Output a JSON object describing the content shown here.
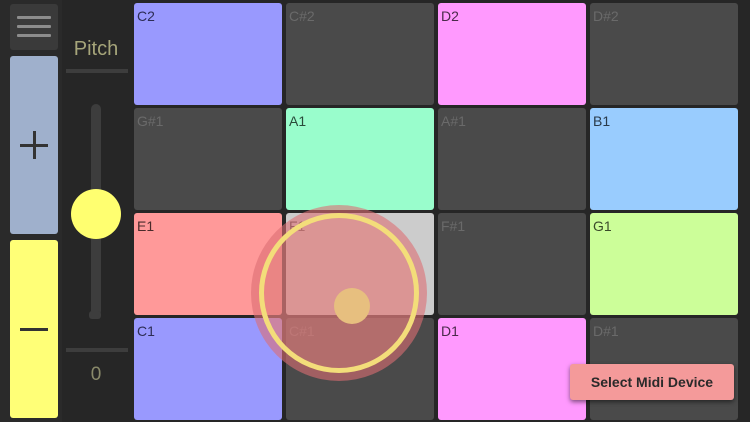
{
  "left_panel": {
    "menu_icon": "hamburger-menu-icon",
    "plus_icon": "plus-icon",
    "minus_icon": "minus-icon"
  },
  "pitch": {
    "label": "Pitch",
    "value": "0",
    "level": 0.5
  },
  "pads": [
    {
      "label": "C2",
      "color": "#9999fe",
      "label_color": "#2d2d55",
      "dim": false
    },
    {
      "label": "C#2",
      "color": "#4a4a4a",
      "label_color": "#6a6a6a",
      "dim": true
    },
    {
      "label": "D2",
      "color": "#ff99fe",
      "label_color": "#4a2a4a",
      "dim": false
    },
    {
      "label": "D#2",
      "color": "#4a4a4a",
      "label_color": "#6a6a6a",
      "dim": true
    },
    {
      "label": "G#1",
      "color": "#4a4a4a",
      "label_color": "#6a6a6a",
      "dim": true
    },
    {
      "label": "A1",
      "color": "#99fdcc",
      "label_color": "#2a4a3a",
      "dim": false
    },
    {
      "label": "A#1",
      "color": "#4a4a4a",
      "label_color": "#6a6a6a",
      "dim": true
    },
    {
      "label": "B1",
      "color": "#99ccfe",
      "label_color": "#2a3a4a",
      "dim": false
    },
    {
      "label": "E1",
      "color": "#ff9999",
      "label_color": "#4a2a2a",
      "dim": false
    },
    {
      "label": "F1",
      "color": "#cccccc",
      "label_color": "#4a4a4a",
      "dim": false
    },
    {
      "label": "F#1",
      "color": "#4a4a4a",
      "label_color": "#6a6a6a",
      "dim": true
    },
    {
      "label": "G1",
      "color": "#ccfe99",
      "label_color": "#3a4a2a",
      "dim": false
    },
    {
      "label": "C1",
      "color": "#9999fe",
      "label_color": "#2d2d55",
      "dim": false
    },
    {
      "label": "C#1",
      "color": "#4a4a4a",
      "label_color": "#6a6a6a",
      "dim": true
    },
    {
      "label": "D1",
      "color": "#ff99fe",
      "label_color": "#4a2a4a",
      "dim": false
    },
    {
      "label": "D#1",
      "color": "#4a4a4a",
      "label_color": "#6a6a6a",
      "dim": true
    }
  ],
  "midi_button": {
    "label": "Select Midi Device",
    "color": "#f49a9a"
  }
}
